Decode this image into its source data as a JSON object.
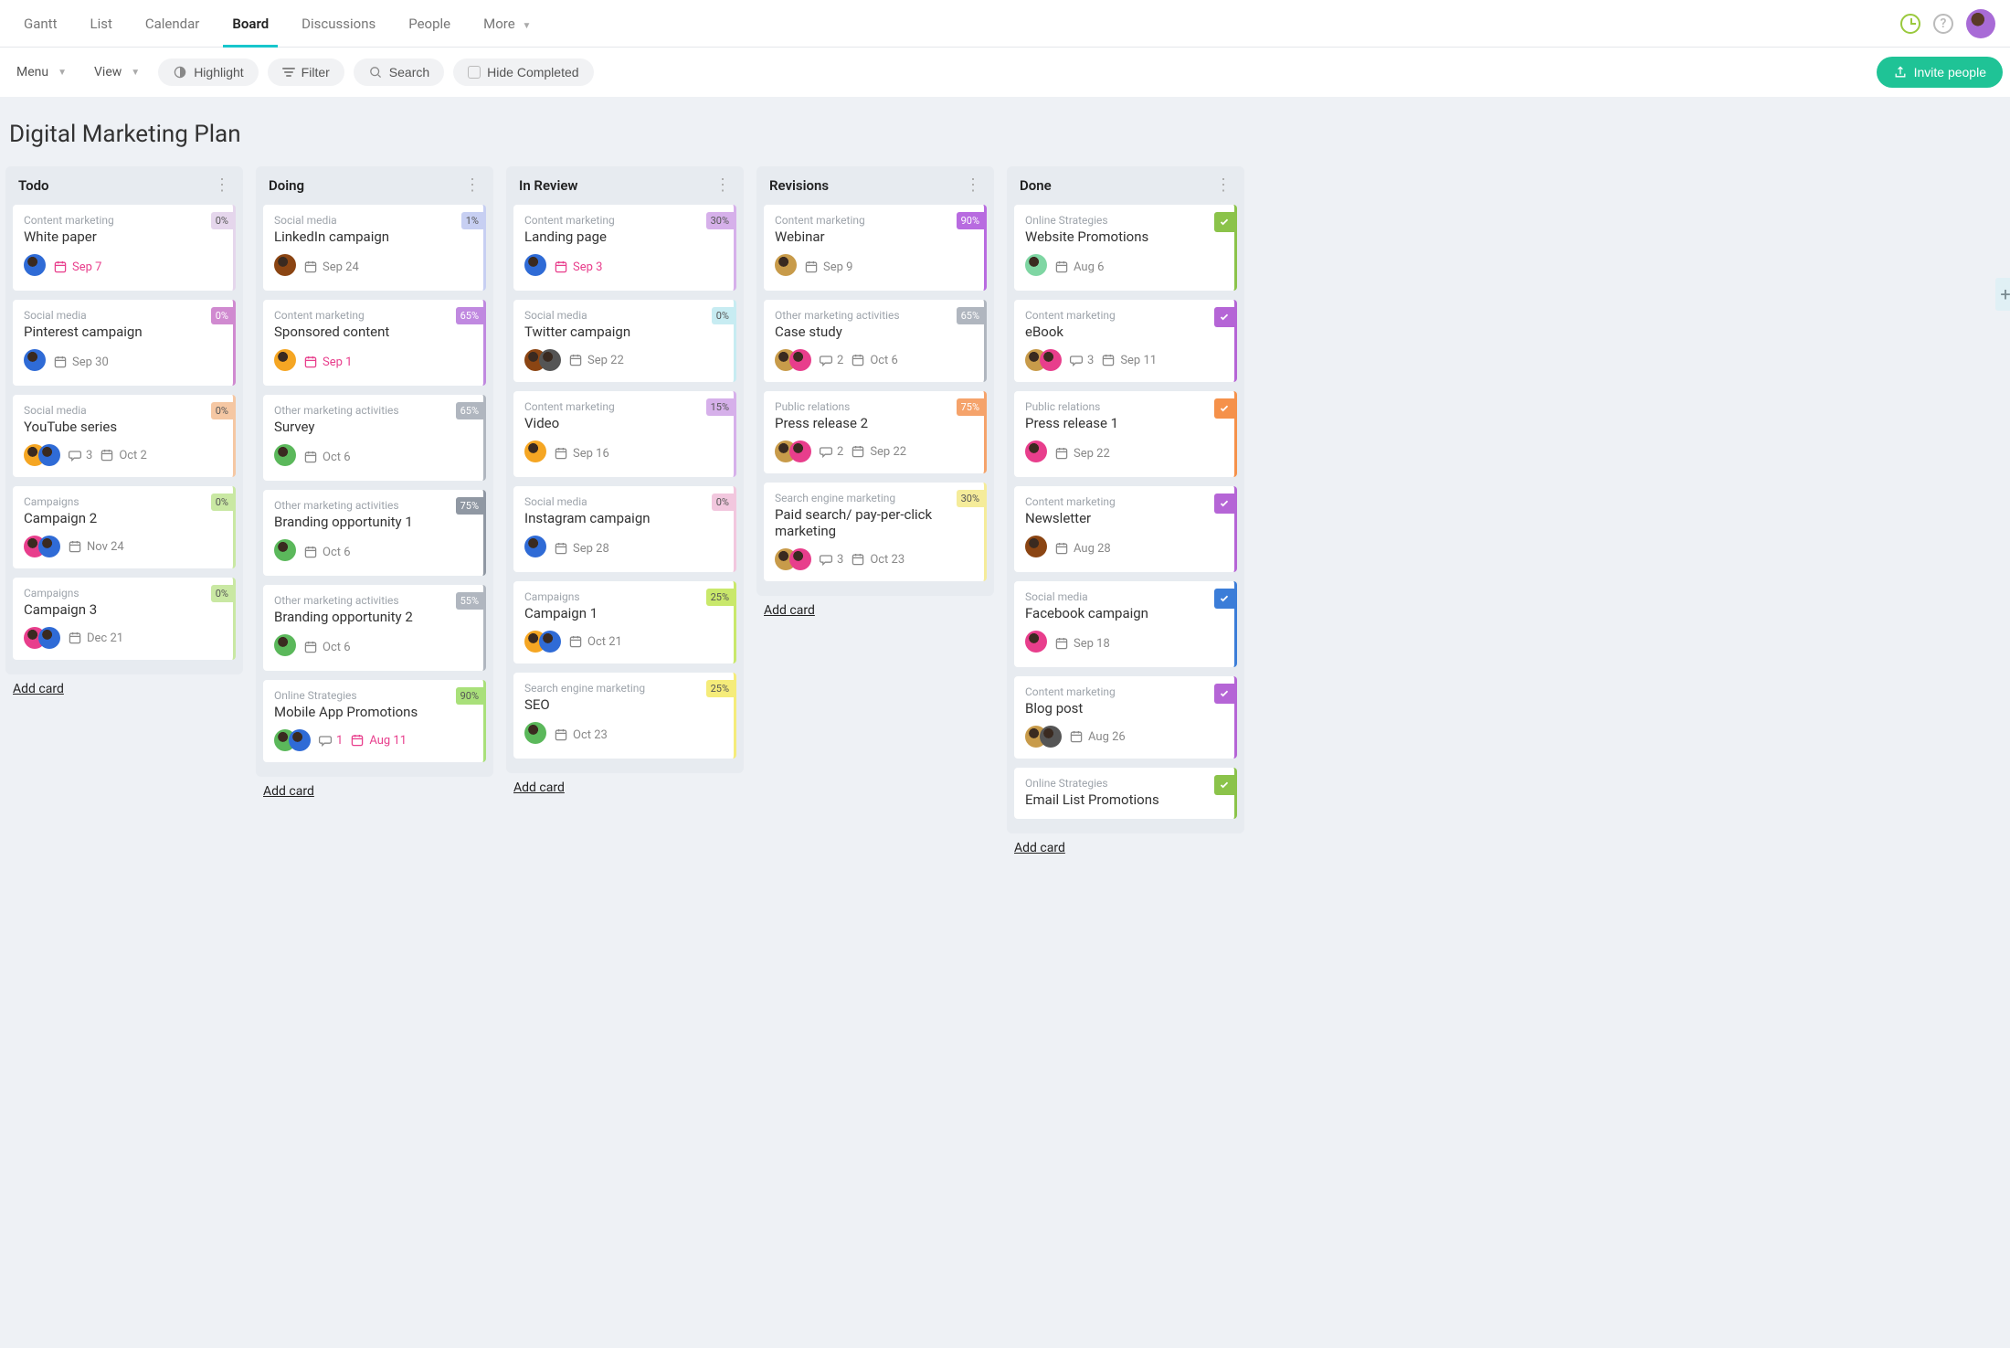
{
  "topnav": {
    "tabs": [
      "Gantt",
      "List",
      "Calendar",
      "Board",
      "Discussions",
      "People",
      "More"
    ],
    "active": "Board"
  },
  "toolbar": {
    "menu": "Menu",
    "view": "View",
    "highlight": "Highlight",
    "filter": "Filter",
    "search": "Search",
    "hide_completed": "Hide Completed",
    "invite": "Invite people"
  },
  "board": {
    "title": "Digital Marketing Plan",
    "add_card_label": "Add card",
    "columns": [
      {
        "title": "Todo",
        "cards": [
          {
            "cat": "Content marketing",
            "title": "White paper",
            "pct": "0%",
            "pctBg": "#e5d6ec",
            "avatars": [
              "#2f6bd6"
            ],
            "date": "Sep 7",
            "urgent": true
          },
          {
            "cat": "Social media",
            "title": "Pinterest campaign",
            "pct": "0%",
            "pctBg": "#d08ad0",
            "pctText": "#fff",
            "avatars": [
              "#2f6bd6"
            ],
            "date": "Sep 30"
          },
          {
            "cat": "Social media",
            "title": "YouTube series",
            "pct": "0%",
            "pctBg": "#f5c7a3",
            "avatars": [
              "#f5a623",
              "#2f6bd6"
            ],
            "comments": "3",
            "date": "Oct 2"
          },
          {
            "cat": "Campaigns",
            "title": "Campaign 2",
            "pct": "0%",
            "pctBg": "#c9e8a3",
            "avatars": [
              "#e83e8c",
              "#2f6bd6"
            ],
            "date": "Nov 24"
          },
          {
            "cat": "Campaigns",
            "title": "Campaign 3",
            "pct": "0%",
            "pctBg": "#c9e8a3",
            "avatars": [
              "#e83e8c",
              "#2f6bd6"
            ],
            "date": "Dec 21"
          }
        ]
      },
      {
        "title": "Doing",
        "cards": [
          {
            "cat": "Social media",
            "title": "LinkedIn campaign",
            "pct": "1%",
            "pctBg": "#c7cff2",
            "avatars": [
              "#8b4513"
            ],
            "date": "Sep 24"
          },
          {
            "cat": "Content marketing",
            "title": "Sponsored content",
            "pct": "65%",
            "pctBg": "#c089e0",
            "pctText": "#fff",
            "avatars": [
              "#f5a623"
            ],
            "date": "Sep 1",
            "urgent": true
          },
          {
            "cat": "Other marketing activities",
            "title": "Survey",
            "pct": "65%",
            "pctBg": "#b0b6bf",
            "pctText": "#fff",
            "avatars": [
              "#5bb85b"
            ],
            "date": "Oct 6"
          },
          {
            "cat": "Other marketing activities",
            "title": "Branding opportunity 1",
            "pct": "75%",
            "pctBg": "#9098a3",
            "pctText": "#fff",
            "avatars": [
              "#5bb85b"
            ],
            "date": "Oct 6"
          },
          {
            "cat": "Other marketing activities",
            "title": "Branding opportunity 2",
            "pct": "55%",
            "pctBg": "#b0b6bf",
            "pctText": "#fff",
            "avatars": [
              "#5bb85b"
            ],
            "date": "Oct 6"
          },
          {
            "cat": "Online Strategies",
            "title": "Mobile App Promotions",
            "pct": "90%",
            "pctBg": "#a9e07a",
            "avatars": [
              "#5bb85b",
              "#2f6bd6"
            ],
            "comments": "1",
            "urgentComments": true,
            "date": "Aug 11",
            "urgent": true
          }
        ]
      },
      {
        "title": "In Review",
        "cards": [
          {
            "cat": "Content marketing",
            "title": "Landing page",
            "pct": "30%",
            "pctBg": "#d6b0ea",
            "avatars": [
              "#2f6bd6"
            ],
            "date": "Sep 3",
            "urgent": true
          },
          {
            "cat": "Social media",
            "title": "Twitter campaign",
            "pct": "0%",
            "pctBg": "#c7ecf2",
            "avatars": [
              "#8b4513",
              "#555"
            ],
            "date": "Sep 22"
          },
          {
            "cat": "Content marketing",
            "title": "Video",
            "pct": "15%",
            "pctBg": "#d6b0ea",
            "avatars": [
              "#f5a623"
            ],
            "date": "Sep 16"
          },
          {
            "cat": "Social media",
            "title": "Instagram campaign",
            "pct": "0%",
            "pctBg": "#f2c7de",
            "avatars": [
              "#2f6bd6"
            ],
            "date": "Sep 28"
          },
          {
            "cat": "Campaigns",
            "title": "Campaign 1",
            "pct": "25%",
            "pctBg": "#c9e86b",
            "avatars": [
              "#f5a623",
              "#2f6bd6"
            ],
            "date": "Oct 21"
          },
          {
            "cat": "Search engine marketing",
            "title": "SEO",
            "pct": "25%",
            "pctBg": "#f5ec7a",
            "avatars": [
              "#5bb85b"
            ],
            "date": "Oct 23"
          }
        ]
      },
      {
        "title": "Revisions",
        "cards": [
          {
            "cat": "Content marketing",
            "title": "Webinar",
            "pct": "90%",
            "pctBg": "#b86be0",
            "pctText": "#fff",
            "avatars": [
              "#c89b4a"
            ],
            "date": "Sep 9"
          },
          {
            "cat": "Other marketing activities",
            "title": "Case study",
            "pct": "65%",
            "pctBg": "#b0b6bf",
            "pctText": "#fff",
            "avatars": [
              "#c89b4a",
              "#e83e8c"
            ],
            "comments": "2",
            "date": "Oct 6"
          },
          {
            "cat": "Public relations",
            "title": "Press release 2",
            "pct": "75%",
            "pctBg": "#f5a36b",
            "pctText": "#fff",
            "avatars": [
              "#c89b4a",
              "#e83e8c"
            ],
            "comments": "2",
            "date": "Sep 22"
          },
          {
            "cat": "Search engine marketing",
            "title": "Paid search/ pay-per-click marketing",
            "pct": "30%",
            "pctBg": "#f5ec9a",
            "avatars": [
              "#c89b4a",
              "#e83e8c"
            ],
            "comments": "3",
            "date": "Oct 23"
          }
        ]
      },
      {
        "title": "Done",
        "cards": [
          {
            "cat": "Online Strategies",
            "title": "Website Promotions",
            "done": true,
            "doneBg": "#8bc34a",
            "avatars": [
              "#7fd6a3"
            ],
            "date": "Aug 6"
          },
          {
            "cat": "Content marketing",
            "title": "eBook",
            "done": true,
            "doneBg": "#b565d6",
            "avatars": [
              "#c89b4a",
              "#e83e8c"
            ],
            "comments": "3",
            "date": "Sep 11"
          },
          {
            "cat": "Public relations",
            "title": "Press release 1",
            "done": true,
            "doneBg": "#f5914a",
            "avatars": [
              "#e83e8c"
            ],
            "date": "Sep 22"
          },
          {
            "cat": "Content marketing",
            "title": "Newsletter",
            "done": true,
            "doneBg": "#b565d6",
            "avatars": [
              "#8b4513"
            ],
            "date": "Aug 28"
          },
          {
            "cat": "Social media",
            "title": "Facebook campaign",
            "done": true,
            "doneBg": "#3b7dd8",
            "avatars": [
              "#e83e8c"
            ],
            "date": "Sep 18"
          },
          {
            "cat": "Content marketing",
            "title": "Blog post",
            "done": true,
            "doneBg": "#b565d6",
            "avatars": [
              "#c89b4a",
              "#555"
            ],
            "date": "Aug 26"
          },
          {
            "cat": "Online Strategies",
            "title": "Email List Promotions",
            "done": true,
            "doneBg": "#8bc34a",
            "avatars": []
          }
        ]
      }
    ]
  },
  "avatarTopRight": "#a86bd6"
}
